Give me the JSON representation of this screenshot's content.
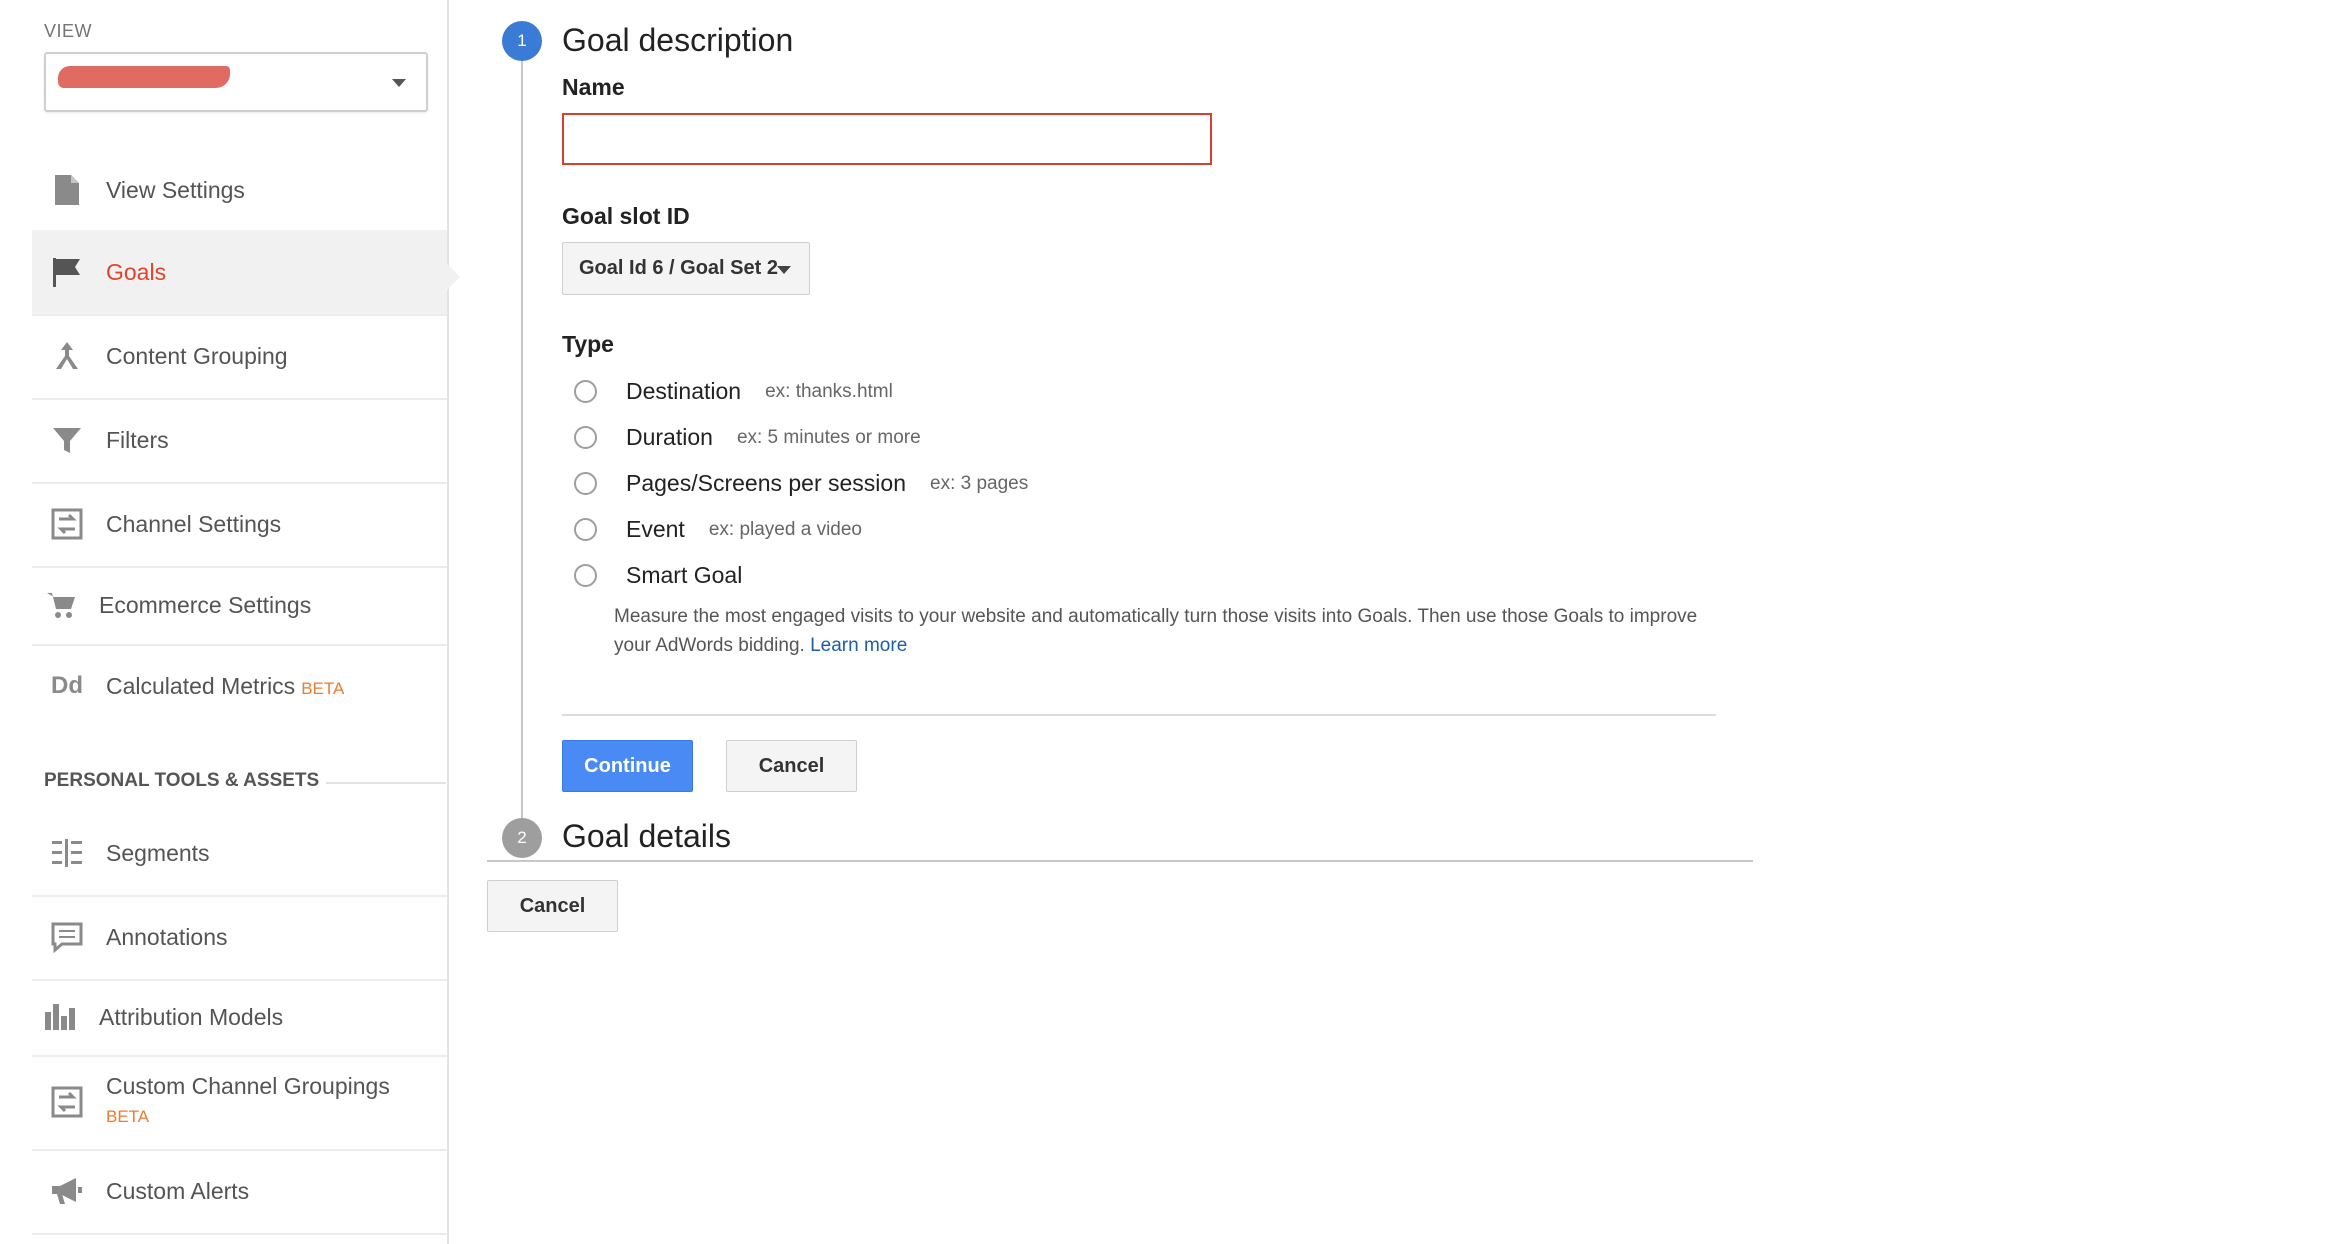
{
  "sidebar": {
    "view_label": "VIEW",
    "nav_items": [
      {
        "label": "View Settings",
        "icon": "document-icon"
      },
      {
        "label": "Goals",
        "icon": "flag-icon"
      },
      {
        "label": "Content Grouping",
        "icon": "grouping-icon"
      },
      {
        "label": "Filters",
        "icon": "filter-icon"
      },
      {
        "label": "Channel Settings",
        "icon": "channel-icon"
      },
      {
        "label": "Ecommerce Settings",
        "icon": "cart-icon"
      },
      {
        "label": "Calculated Metrics",
        "badge": "BETA",
        "icon": "dd-icon"
      }
    ],
    "section_heading": "PERSONAL TOOLS & ASSETS",
    "tool_items": [
      {
        "label": "Segments",
        "icon": "segments-icon"
      },
      {
        "label": "Annotations",
        "icon": "annotation-icon"
      },
      {
        "label": "Attribution Models",
        "icon": "bar-chart-icon"
      },
      {
        "label": "Custom Channel Groupings",
        "badge": "BETA",
        "icon": "channel-icon"
      },
      {
        "label": "Custom Alerts",
        "icon": "megaphone-icon"
      }
    ],
    "dd_glyph": "Dd"
  },
  "main": {
    "step1": {
      "number": "1",
      "title": "Goal description"
    },
    "name_label": "Name",
    "name_value": "",
    "slot_label": "Goal slot ID",
    "slot_value": "Goal Id 6 / Goal Set 2",
    "type_label": "Type",
    "types": [
      {
        "label": "Destination",
        "example": "ex: thanks.html"
      },
      {
        "label": "Duration",
        "example": "ex: 5 minutes or more"
      },
      {
        "label": "Pages/Screens per session",
        "example": "ex: 3 pages"
      },
      {
        "label": "Event",
        "example": "ex: played a video"
      },
      {
        "label": "Smart Goal",
        "example": ""
      }
    ],
    "smart_desc": "Measure the most engaged visits to your website and automatically turn those visits into Goals. Then use those Goals to improve your AdWords bidding.",
    "learn_more": "Learn more",
    "continue_label": "Continue",
    "cancel_label": "Cancel",
    "step2": {
      "number": "2",
      "title": "Goal details"
    },
    "bottom_cancel_label": "Cancel"
  },
  "colors": {
    "accent_blue": "#4a8af4",
    "active_red": "#e0452a",
    "beta_orange": "#ee7c2e",
    "error_red": "#d93f30"
  }
}
